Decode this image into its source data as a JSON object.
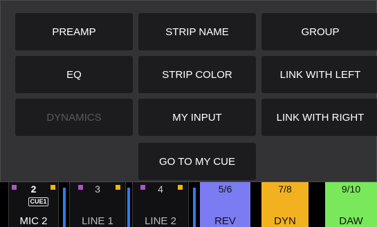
{
  "menu": {
    "preamp": "PREAMP",
    "strip_name": "STRIP NAME",
    "group": "GROUP",
    "eq": "EQ",
    "strip_color": "STRIP COLOR",
    "link_left": "LINK WITH LEFT",
    "dynamics": "DYNAMICS",
    "my_input": "MY INPUT",
    "link_right": "LINK WITH RIGHT",
    "go_to_cue": "GO TO MY CUE"
  },
  "strips": [
    {
      "num": "2",
      "cue": "CUE1",
      "name": "MIC 2"
    },
    {
      "num": "3",
      "name": "LINE 1"
    },
    {
      "num": "4",
      "name": "LINE 2"
    },
    {
      "num": "5/6",
      "name": "REV",
      "color": "#7b7cf2"
    },
    {
      "num": "7/8",
      "name": "DYN",
      "color": "#f2b21f"
    },
    {
      "num": "9/10",
      "name": "DAW",
      "color": "#79e85b"
    }
  ],
  "colors": {
    "panel_bg": "#333336",
    "button_bg": "#1c1c1e",
    "accent_blue": "#2f7de8",
    "square_purple": "#b24fc9",
    "square_yellow": "#f5b400"
  }
}
